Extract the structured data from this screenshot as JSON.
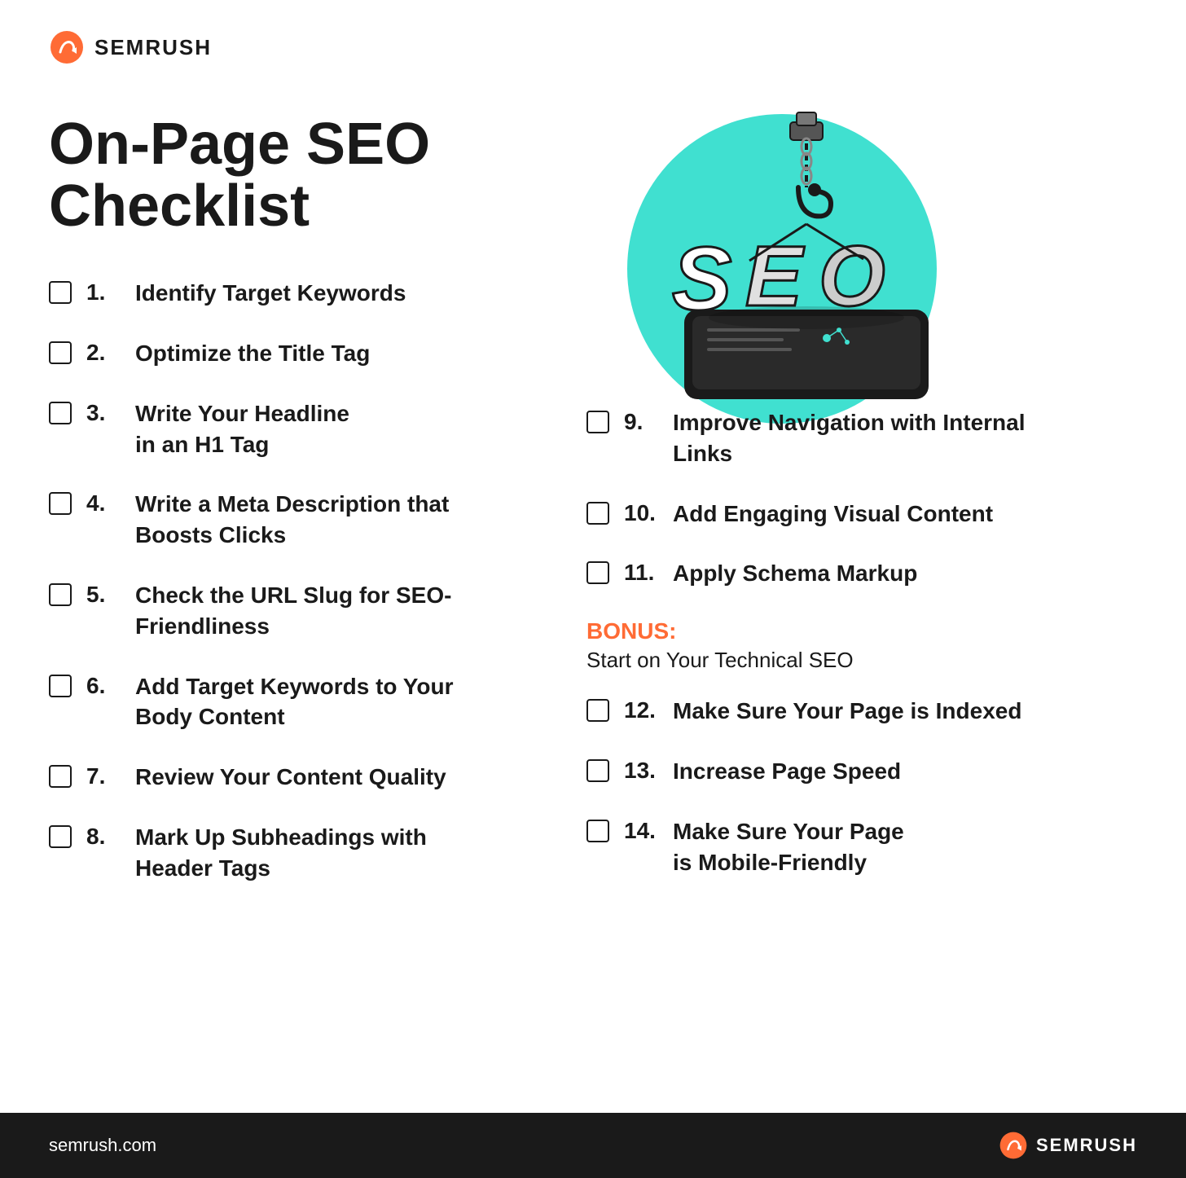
{
  "logo": {
    "text": "SEMRUSH",
    "url_text": "semrush.com"
  },
  "page_title": "On-Page SEO Checklist",
  "checklist_left": [
    {
      "number": "1.",
      "text": "Identify Target Keywords"
    },
    {
      "number": "2.",
      "text": "Optimize the Title Tag"
    },
    {
      "number": "3.",
      "text": "Write Your Headline\nin an H1 Tag"
    },
    {
      "number": "4.",
      "text": "Write a Meta Description that\nBoosts Clicks"
    },
    {
      "number": "5.",
      "text": "Check the URL Slug for SEO-\nFriendliness"
    },
    {
      "number": "6.",
      "text": "Add Target Keywords to Your\nBody Content"
    },
    {
      "number": "7.",
      "text": "Review Your Content Quality"
    },
    {
      "number": "8.",
      "text": "Mark Up Subheadings with\nHeader Tags"
    }
  ],
  "checklist_right": [
    {
      "number": "9.",
      "text": "Improve Navigation with Internal\nLinks"
    },
    {
      "number": "10.",
      "text": "Add Engaging Visual Content"
    },
    {
      "number": "11.",
      "text": "Apply Schema Markup"
    },
    {
      "number": "12.",
      "text": "Make Sure Your Page is Indexed"
    },
    {
      "number": "13.",
      "text": "Increase Page Speed"
    },
    {
      "number": "14.",
      "text": "Make Sure Your Page\nis Mobile-Friendly"
    }
  ],
  "bonus": {
    "label": "BONUS:",
    "description": "Start on Your Technical SEO"
  },
  "colors": {
    "accent": "#ff6b35",
    "dark": "#1a1a1a",
    "cyan": "#40e0d0",
    "white": "#ffffff"
  }
}
